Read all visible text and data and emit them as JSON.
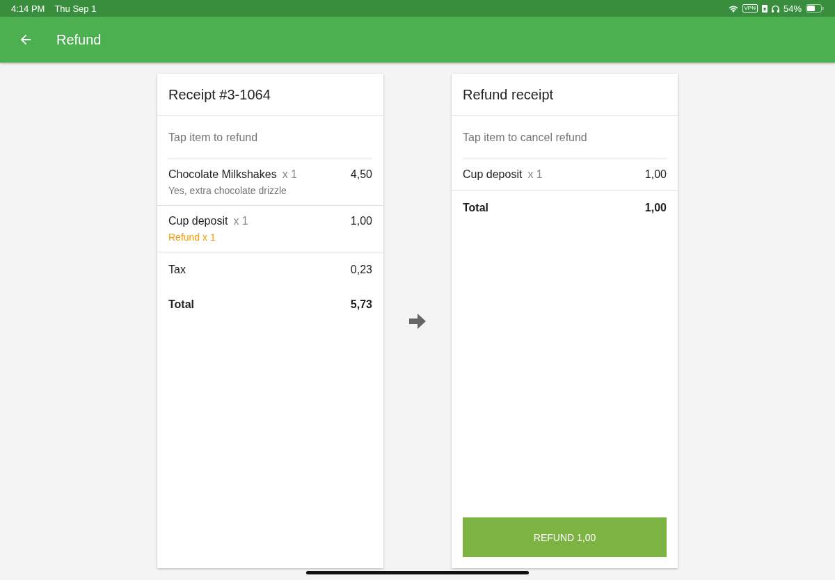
{
  "status_bar": {
    "time": "4:14 PM",
    "date": "Thu Sep 1",
    "vpn": "VPN",
    "battery": "54%"
  },
  "app_bar": {
    "title": "Refund"
  },
  "receipt": {
    "title": "Receipt #3-1064",
    "hint": "Tap item to refund",
    "items": [
      {
        "kind": "modifier",
        "name": "Chocolate Milkshakes",
        "qty": "x 1",
        "price": "4,50",
        "note": "Yes, extra chocolate drizzle"
      },
      {
        "kind": "refund",
        "name": "Cup deposit",
        "qty": "x 1",
        "price": "1,00",
        "note": "Refund x 1"
      }
    ],
    "summary": [
      {
        "kind": "regular",
        "label": "Tax",
        "value": "0,23"
      },
      {
        "kind": "total",
        "label": "Total",
        "value": "5,73"
      }
    ]
  },
  "refund_receipt": {
    "title": "Refund receipt",
    "hint": "Tap item to cancel refund",
    "items": [
      {
        "name": "Cup deposit",
        "qty": "x 1",
        "price": "1,00"
      }
    ],
    "summary": [
      {
        "kind": "total",
        "label": "Total",
        "value": "1,00"
      }
    ],
    "button": "REFUND 1,00"
  }
}
